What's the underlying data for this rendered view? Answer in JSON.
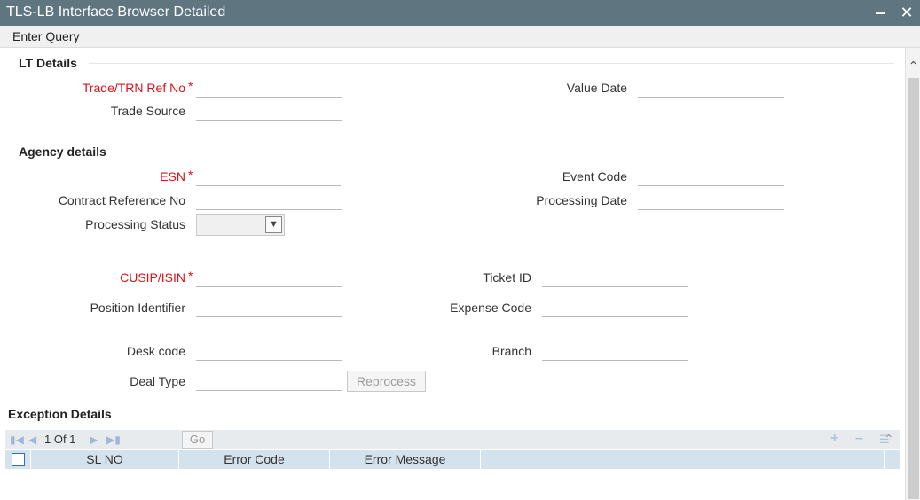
{
  "window": {
    "title": "TLS-LB Interface Browser Detailed",
    "minimize_glyph": "‒",
    "close_glyph": "✕"
  },
  "menu": {
    "enter_query": "Enter Query"
  },
  "lt_details": {
    "title": "LT Details",
    "trade_ref_label": "Trade/TRN Ref No",
    "trade_ref_value": "",
    "value_date_label": "Value Date",
    "value_date_value": "",
    "trade_source_label": "Trade Source",
    "trade_source_value": ""
  },
  "agency_details": {
    "title": "Agency details",
    "esn_label": "ESN",
    "esn_value": "",
    "event_code_label": "Event Code",
    "event_code_value": "",
    "contract_ref_label": "Contract Reference No",
    "contract_ref_value": "",
    "processing_date_label": "Processing Date",
    "processing_date_value": "",
    "processing_status_label": "Processing Status",
    "processing_status_value": "",
    "cusip_label": "CUSIP/ISIN",
    "cusip_value": "",
    "ticket_id_label": "Ticket ID",
    "ticket_id_value": "",
    "position_id_label": "Position Identifier",
    "position_id_value": "",
    "expense_code_label": "Expense Code",
    "expense_code_value": "",
    "desk_code_label": "Desk code",
    "desk_code_value": "",
    "branch_label": "Branch",
    "branch_value": "",
    "deal_type_label": "Deal Type",
    "deal_type_value": "",
    "reprocess_label": "Reprocess"
  },
  "required_marker": "*",
  "exception_details": {
    "title": "Exception Details",
    "page_text": "1 Of 1",
    "go_label": "Go",
    "columns": [
      "SL NO",
      "Error Code",
      "Error Message"
    ]
  },
  "icons": {
    "first_page": "first-page-icon",
    "prev_page": "prev-page-icon",
    "next_page": "next-page-icon",
    "last_page": "last-page-icon",
    "add_row": "plus-icon",
    "delete_row": "minus-icon",
    "single_view": "list-icon",
    "dropdown": "chevron-down-icon"
  },
  "colors": {
    "titlebar": "#5f7580",
    "required": "#d6141c",
    "grid_header": "#d3e2ec",
    "nav_icon": "#9fb7d8"
  }
}
